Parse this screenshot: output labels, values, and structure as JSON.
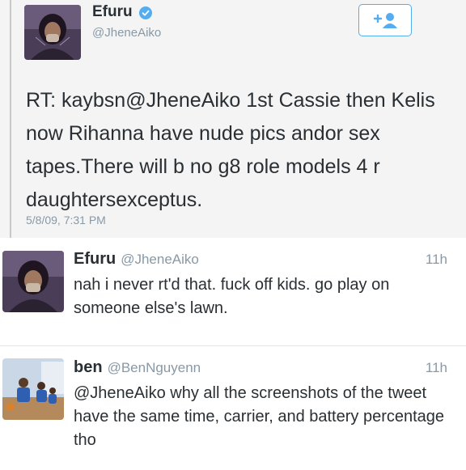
{
  "embedded_tweet": {
    "name": "Efuru",
    "handle": "@JheneAiko",
    "body": "RT: kaybsn@JheneAiko 1st Cassie then Kelis now Rihanna have nude pics andor sex tapes.There will b no g8 role models 4 r daughtersexceptus.",
    "timestamp": "5/8/09, 7:31 PM",
    "follow_icon": "follow-plus-person-icon",
    "verified_icon": "verified-badge-icon"
  },
  "replies": [
    {
      "name": "Efuru",
      "handle": "@JheneAiko",
      "time_ago": "11h",
      "text": "nah i never rt'd that. fuck off kids. go play on someone else's lawn."
    },
    {
      "name": "ben",
      "handle": "@BenNguyenn",
      "time_ago": "11h",
      "text": "@JheneAiko why all the screenshots of the tweet have the same time, carrier, and battery percentage tho"
    }
  ],
  "colors": {
    "twitter_blue": "#55acee",
    "text": "#292f33",
    "muted": "#8899a6",
    "embed_bg": "#f4f4f4"
  }
}
